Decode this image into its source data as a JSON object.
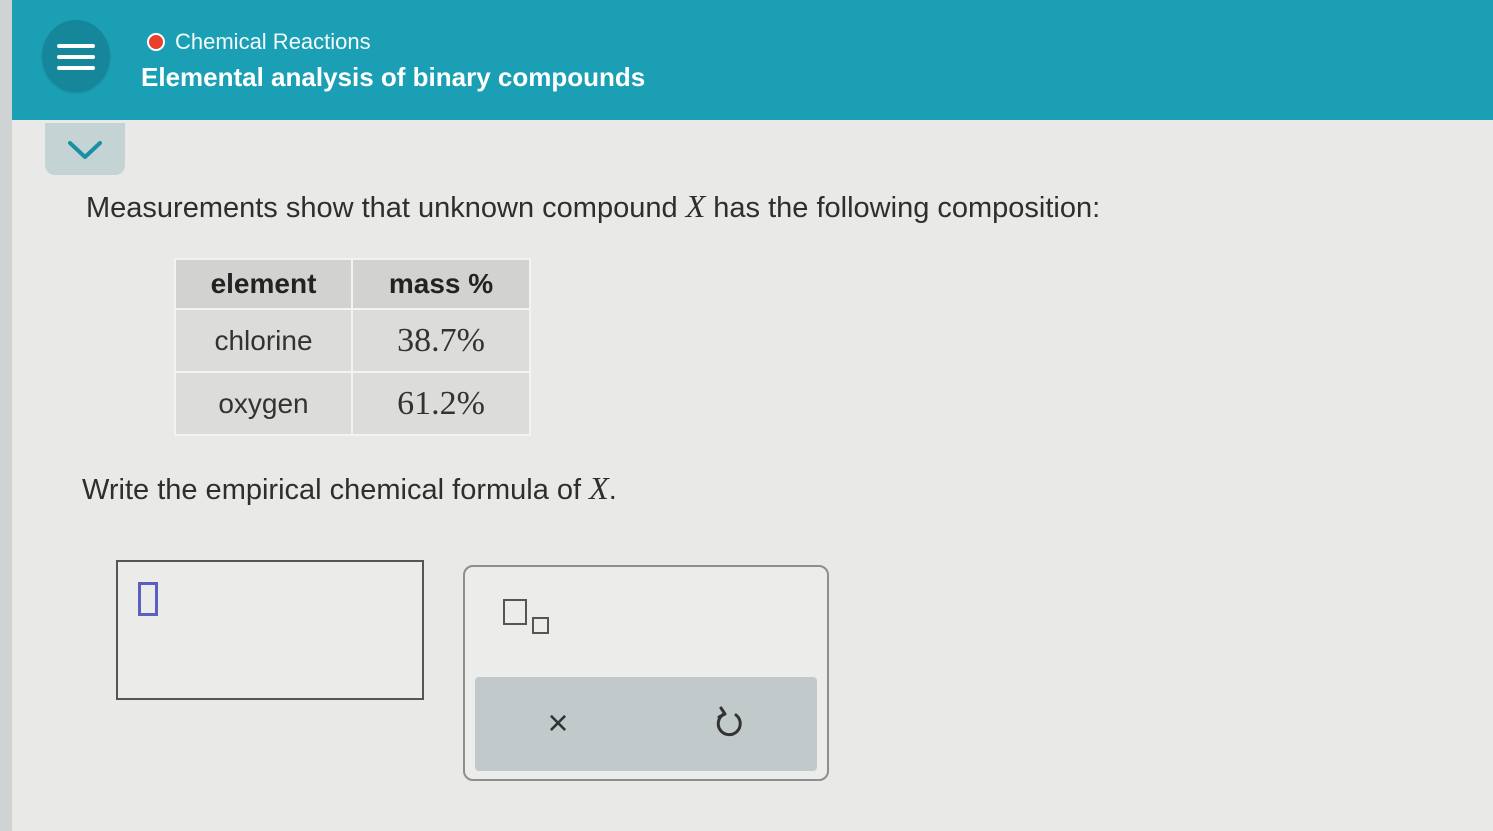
{
  "header": {
    "topic": "Chemical Reactions",
    "title": "Elemental analysis of binary compounds",
    "topic_dot_color": "#e8402c",
    "background_color": "#1b9fb4"
  },
  "icons": {
    "menu": "hamburger-menu-icon",
    "collapse": "chevron-down-icon",
    "subscript": "subscript-template-icon",
    "clear": "x-icon",
    "undo": "undo-icon"
  },
  "prompt": {
    "before": "Measurements show that unknown compound",
    "variable": "X",
    "after": "has the following composition:"
  },
  "table": {
    "headers": [
      "element",
      "mass %"
    ],
    "rows": [
      {
        "element": "chlorine",
        "mass": "38.7%"
      },
      {
        "element": "oxygen",
        "mass": "61.2%"
      }
    ]
  },
  "question": {
    "before": "Write the empirical chemical formula of",
    "variable": "X",
    "after": "."
  },
  "toolbar": {
    "clear_symbol": "×"
  }
}
